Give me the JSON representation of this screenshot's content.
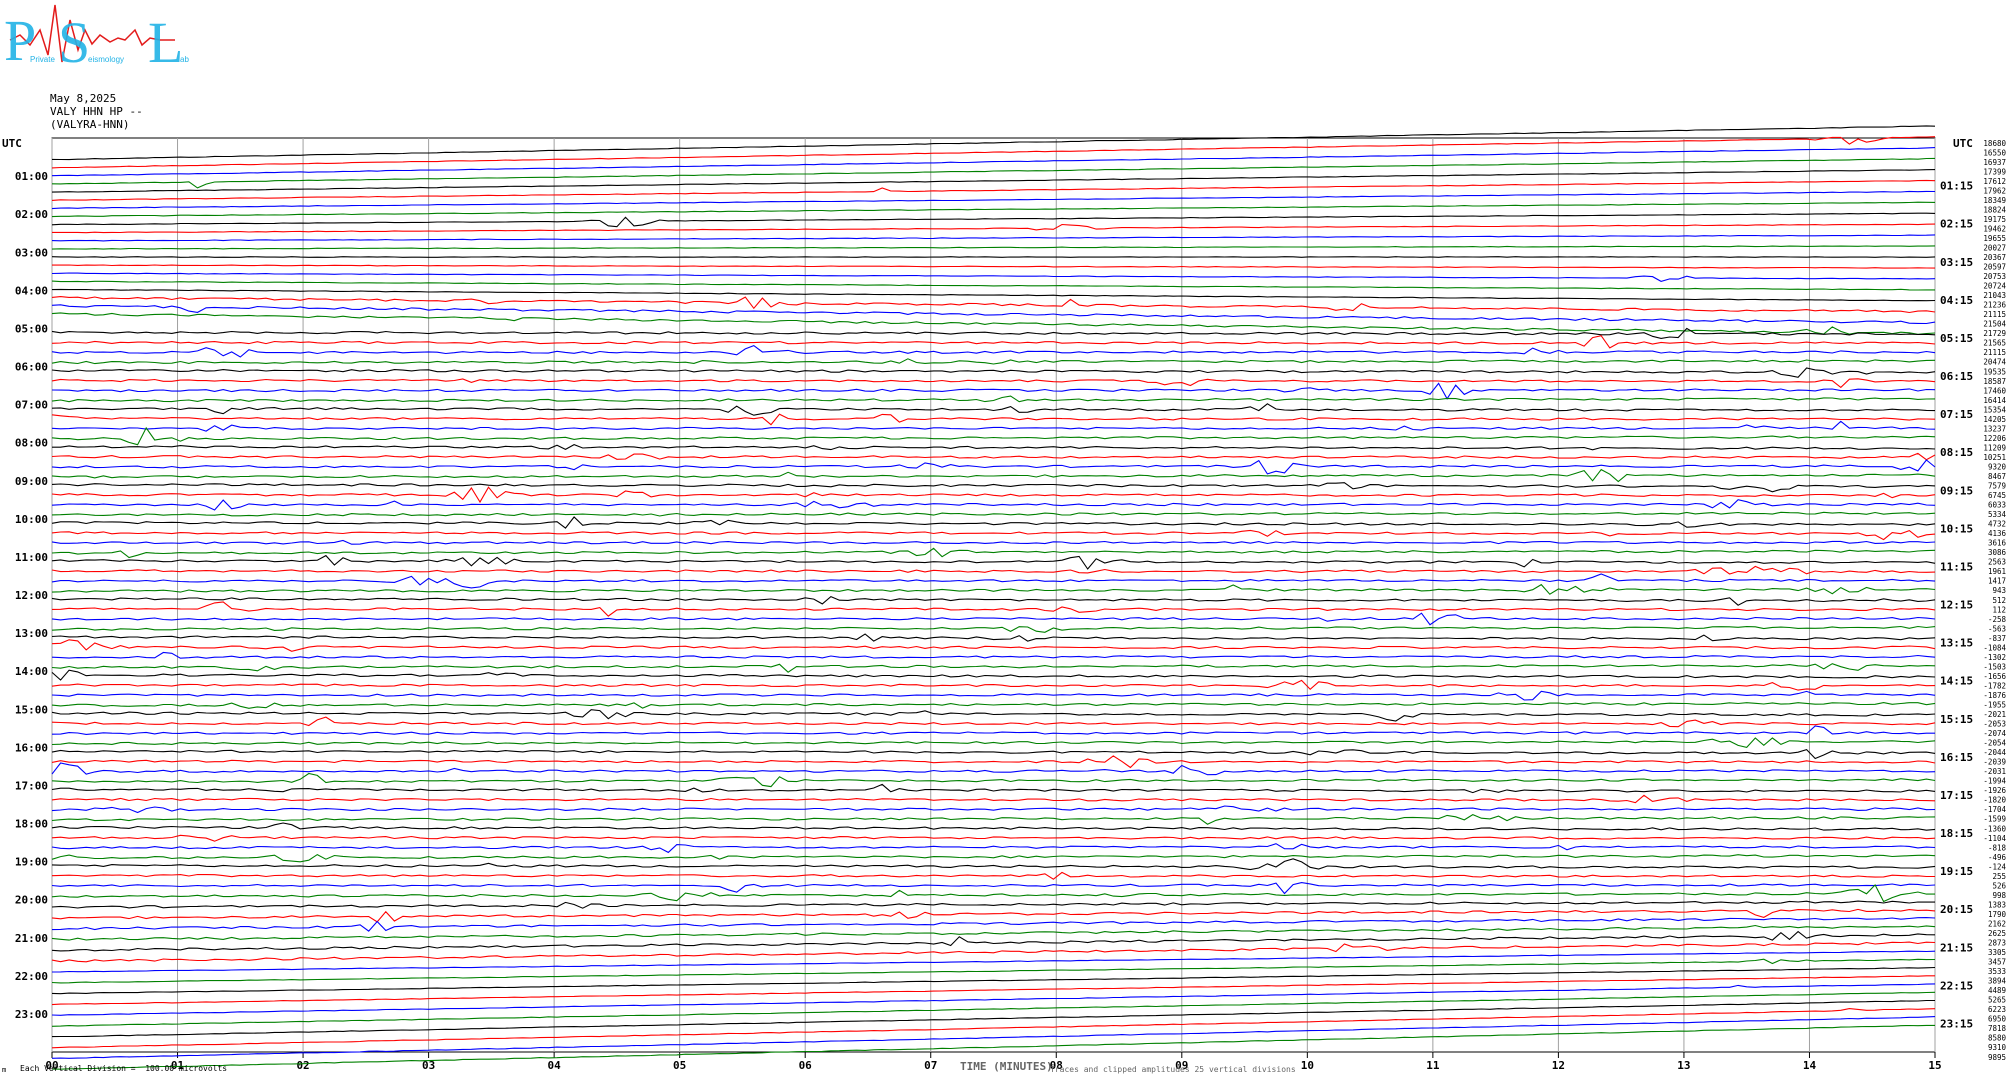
{
  "logo": {
    "letters": [
      "P",
      "S",
      "L"
    ],
    "small_words": [
      "Private",
      "eismology",
      "ab"
    ],
    "color": "#22b3e6",
    "wave_color": "#e31b1b"
  },
  "header": {
    "date": "May 8,2025",
    "station": "VALY HHN HP --",
    "name": "(VALYRA-HNN)"
  },
  "axes": {
    "left_title": "UTC",
    "right_title": "UTC"
  },
  "footer": {
    "scale_note": "Each Vertical Division =  100.00 microvolts",
    "x_title": "TIME (MINUTES)",
    "x_note": "Traces and clipped amplitudes 25 vertical divisions",
    "corner": "m"
  },
  "colors": {
    "trace_cycle": [
      "#000000",
      "#ff0000",
      "#0000ff",
      "#008000"
    ],
    "grid": "#a0a0a0"
  },
  "chart_data": {
    "type": "line",
    "title": "",
    "xlabel": "TIME (MINUTES)",
    "ylabel": "UTC",
    "xlim": [
      0,
      15
    ],
    "x_ticks": [
      "00",
      "01",
      "02",
      "03",
      "04",
      "05",
      "06",
      "07",
      "08",
      "09",
      "10",
      "11",
      "12",
      "13",
      "14",
      "15"
    ],
    "left_ticks": [
      "01:00",
      "02:00",
      "03:00",
      "04:00",
      "05:00",
      "06:00",
      "07:00",
      "08:00",
      "09:00",
      "10:00",
      "11:00",
      "12:00",
      "13:00",
      "14:00",
      "15:00",
      "16:00",
      "17:00",
      "18:00",
      "19:00",
      "20:00",
      "21:00",
      "22:00",
      "23:00"
    ],
    "right_ticks": [
      "01:15",
      "02:15",
      "03:15",
      "04:15",
      "05:15",
      "06:15",
      "07:15",
      "08:15",
      "09:15",
      "10:15",
      "11:15",
      "12:15",
      "13:15",
      "14:15",
      "15:15",
      "16:15",
      "17:15",
      "18:15",
      "19:15",
      "20:15",
      "21:15",
      "22:15",
      "23:15"
    ],
    "trace_minutes": 15,
    "traces_per_hour": 4,
    "trace_count": 96,
    "offsets": [
      "18680",
      "16550",
      "16937",
      "17399",
      "17612",
      "17962",
      "18349",
      "18824",
      "19175",
      "19462",
      "19655",
      "20027",
      "20367",
      "20597",
      "20753",
      "20724",
      "21043",
      "21236",
      "21115",
      "21504",
      "21729",
      "21565",
      "21115",
      "20474",
      "19535",
      "18587",
      "17460",
      "16414",
      "15354",
      "14205",
      "13237",
      "12206",
      "11209",
      "10251",
      "9320",
      "8467",
      "7579",
      "6745",
      "6033",
      "5334",
      "4732",
      "4136",
      "3616",
      "3086",
      "2563",
      "1961",
      "1417",
      "943",
      "512",
      "112",
      "-258",
      "-563",
      "-837",
      "-1084",
      "-1302",
      "-1503",
      "-1656",
      "-1782",
      "-1876",
      "-1955",
      "-2021",
      "-2053",
      "-2074",
      "-2054",
      "-2044",
      "-2039",
      "-2031",
      "-1994",
      "-1926",
      "-1820",
      "-1704",
      "-1599",
      "-1360",
      "-1104",
      "-818",
      "-496",
      "-124",
      "255",
      "526",
      "998",
      "1383",
      "1790",
      "2162",
      "2625",
      "2873",
      "3305",
      "3457",
      "3533",
      "3894",
      "4489",
      "5265",
      "6223",
      "6950",
      "7818",
      "8580",
      "9310",
      "9895"
    ]
  }
}
